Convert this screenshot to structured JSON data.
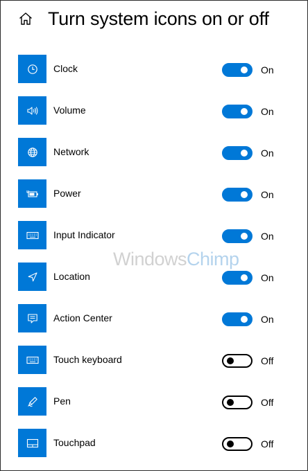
{
  "header": {
    "home_icon": "home-icon",
    "title": "Turn system icons on or off"
  },
  "accent_color": "#0078d7",
  "items": [
    {
      "label": "Clock",
      "icon": "clock-icon",
      "enabled": true,
      "state": "On"
    },
    {
      "label": "Volume",
      "icon": "volume-icon",
      "enabled": true,
      "state": "On"
    },
    {
      "label": "Network",
      "icon": "network-globe-icon",
      "enabled": true,
      "state": "On"
    },
    {
      "label": "Power",
      "icon": "power-battery-icon",
      "enabled": true,
      "state": "On"
    },
    {
      "label": "Input Indicator",
      "icon": "keyboard-icon",
      "enabled": true,
      "state": "On"
    },
    {
      "label": "Location",
      "icon": "location-arrow-icon",
      "enabled": true,
      "state": "On"
    },
    {
      "label": "Action Center",
      "icon": "action-center-icon",
      "enabled": true,
      "state": "On"
    },
    {
      "label": "Touch keyboard",
      "icon": "keyboard-icon",
      "enabled": false,
      "state": "Off"
    },
    {
      "label": "Pen",
      "icon": "pen-icon",
      "enabled": false,
      "state": "Off"
    },
    {
      "label": "Touchpad",
      "icon": "touchpad-icon",
      "enabled": false,
      "state": "Off"
    }
  ],
  "watermark": {
    "text_main": "Windows",
    "text_accent": "Chimp"
  }
}
